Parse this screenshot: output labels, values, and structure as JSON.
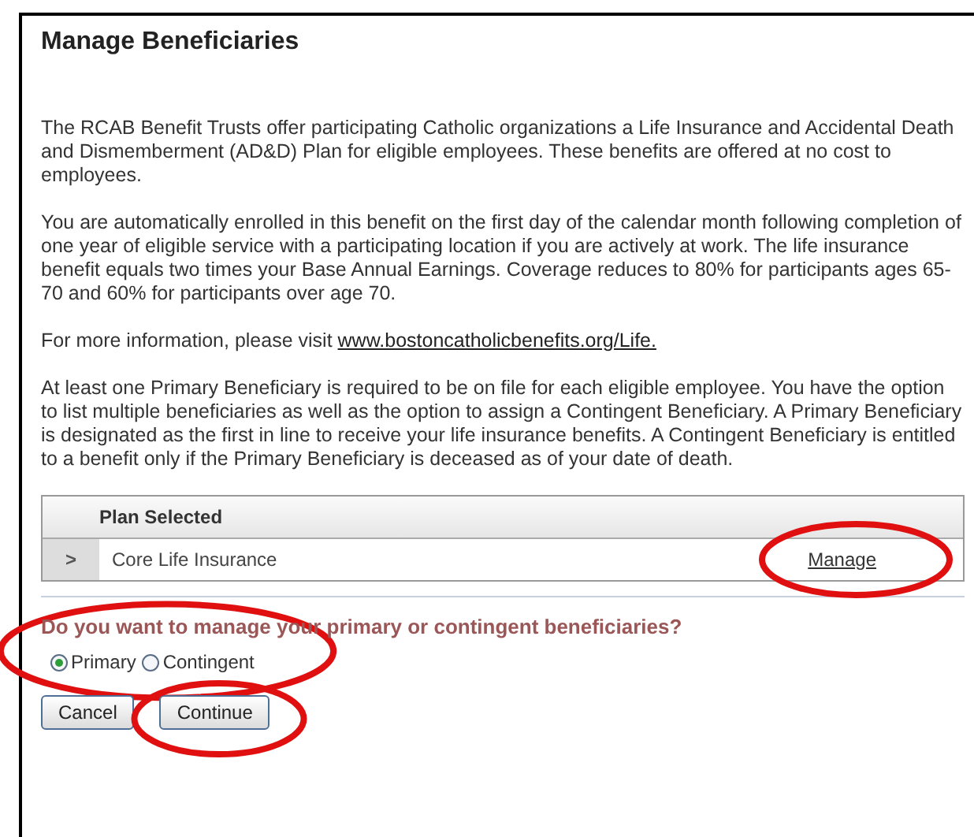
{
  "title": "Manage Beneficiaries",
  "paragraphs": [
    "The RCAB Benefit Trusts offer participating Catholic organizations a Life Insurance and Accidental Death and Dismemberment (AD&D) Plan for eligible employees. These benefits are offered at no cost to employees.",
    "You are automatically enrolled in this benefit on the first day of the calendar month following completion of one year of eligible service with a participating location if you are actively at work.  The life insurance benefit equals two times your Base Annual Earnings.  Coverage reduces to 80% for participants ages 65-70 and 60% for participants over age 70."
  ],
  "info": {
    "text": "For more information, please visit ",
    "link": "www.bostoncatholicbenefits.org/Life."
  },
  "requirement": "At least one Primary Beneficiary is required to be on file for each eligible employee. You have the option to list multiple beneficiaries as well as the option to assign a Contingent Beneficiary.  A Primary Beneficiary is designated as the first in line to receive your life insurance benefits.  A Contingent Beneficiary is entitled to a benefit only if the Primary Beneficiary is deceased as of your date of death.",
  "table": {
    "columns": [
      "Plan Selected"
    ],
    "rows": [
      {
        "expand": ">",
        "plan": "Core Life Insurance",
        "action": "Manage",
        "highlighted": true
      }
    ]
  },
  "question": {
    "text": "Do you want to manage your primary or contingent beneficiaries?",
    "highlighted": true,
    "options": [
      {
        "label": "Primary",
        "selected": true
      },
      {
        "label": "Contingent",
        "selected": false
      }
    ]
  },
  "buttons": [
    {
      "label": "Cancel",
      "highlighted": false
    },
    {
      "label": "Continue",
      "highlighted": true
    }
  ]
}
